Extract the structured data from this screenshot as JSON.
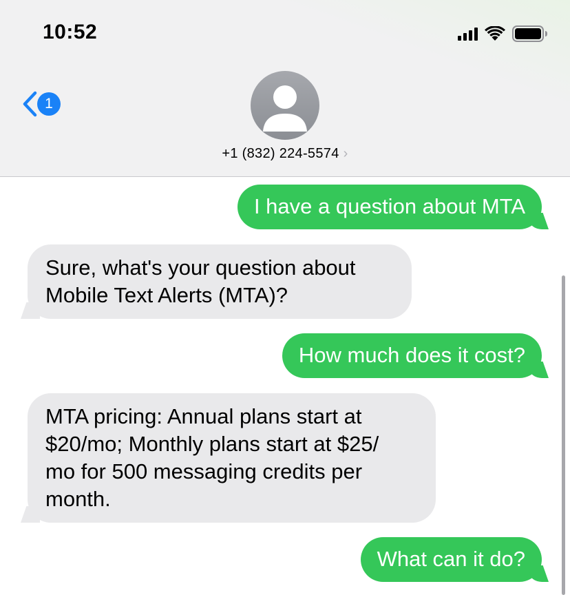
{
  "status_bar": {
    "time": "10:52"
  },
  "nav": {
    "back_badge": "1",
    "contact_name": "+1 (832) 224-5574",
    "contact_chevron": "›"
  },
  "messages": [
    {
      "direction": "outgoing",
      "text": "I have a question about MTA"
    },
    {
      "direction": "incoming",
      "text": "Sure, what's your question about\nMobile Text Alerts (MTA)?"
    },
    {
      "direction": "outgoing",
      "text": "How much does it cost?"
    },
    {
      "direction": "incoming",
      "text": "MTA pricing: Annual plans start at\n$20/mo; Monthly plans start at $25/\nmo for 500 messaging credits per\nmonth."
    },
    {
      "direction": "outgoing",
      "text": "What can it do?"
    }
  ],
  "colors": {
    "outgoing_bubble": "#35c759",
    "incoming_bubble": "#e9e9eb",
    "accent": "#1a82f7",
    "header_bg": "#f1f1f2"
  },
  "icons": [
    "signal-icon",
    "wifi-icon",
    "battery-icon",
    "back-chevron-icon",
    "contact-avatar-icon",
    "chevron-right-icon"
  ]
}
